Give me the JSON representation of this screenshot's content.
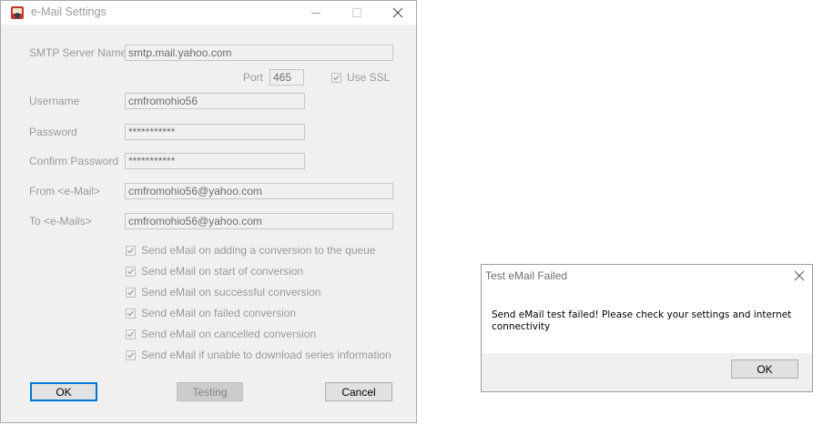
{
  "main_dialog": {
    "title": "e-Mail Settings",
    "icons": {
      "app": "app-icon",
      "minimize": "minimize-icon",
      "maximize": "maximize-icon",
      "close": "close-icon"
    },
    "smtp": {
      "label": "SMTP Server Name",
      "value": "smtp.mail.yahoo.com"
    },
    "port": {
      "label": "Port",
      "value": "465"
    },
    "ssl": {
      "label": "Use SSL",
      "checked": true
    },
    "username": {
      "label": "Username",
      "value": "cmfromohio56"
    },
    "password": {
      "label": "Password",
      "value": "***********"
    },
    "confirm_password": {
      "label": "Confirm Password",
      "value": "***********"
    },
    "from": {
      "label": "From <e-Mail>",
      "value": "cmfromohio56@yahoo.com"
    },
    "to": {
      "label": "To <e-Mails>",
      "value": "cmfromohio56@yahoo.com"
    },
    "options": [
      {
        "label": "Send eMail on adding a conversion to the queue",
        "checked": true
      },
      {
        "label": "Send eMail on start of conversion",
        "checked": true
      },
      {
        "label": "Send eMail on successful conversion",
        "checked": true
      },
      {
        "label": "Send eMail on failed conversion",
        "checked": true
      },
      {
        "label": "Send eMail on cancelled conversion",
        "checked": true
      },
      {
        "label": "Send eMail if unable to download series information",
        "checked": true
      }
    ],
    "buttons": {
      "ok": "OK",
      "testing": "Testing",
      "cancel": "Cancel"
    }
  },
  "error_dialog": {
    "title": "Test eMail Failed",
    "message": "Send eMail test failed! Please check your settings and internet connectivity",
    "ok": "OK"
  },
  "colors": {
    "dialog_bg": "#f0f0f0",
    "disabled_text": "#9a9a9a",
    "focus_border": "#0078d7"
  }
}
